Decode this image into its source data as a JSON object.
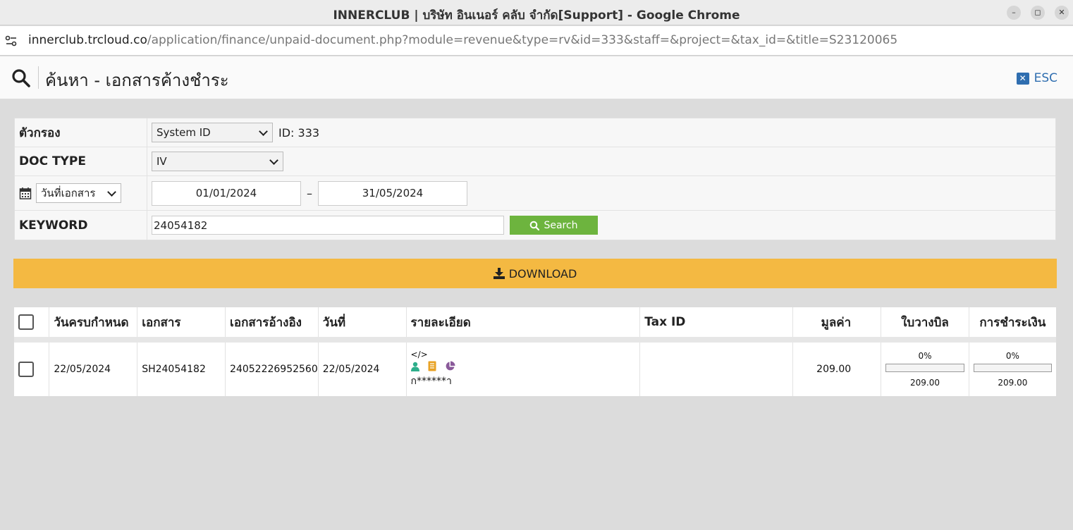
{
  "window": {
    "title": "INNERCLUB | บริษัท อินเนอร์ คลับ จำกัด[Support] - Google Chrome",
    "minimize_glyph": "–",
    "maximize_glyph": "◻",
    "close_glyph": "✕"
  },
  "address": {
    "host": "innerclub.trcloud.co",
    "path": "/application/finance/unpaid-document.php?module=revenue&type=rv&id=333&staff=&project=&tax_id=&title=S23120065"
  },
  "header": {
    "title": "ค้นหา - เอกสารค้างชำระ",
    "esc_label": "ESC"
  },
  "filter": {
    "filter_label": "ตัวกรอง",
    "filter_select": "System ID",
    "filter_value": "ID: 333",
    "doctype_label": "DOC TYPE",
    "doctype_select": "IV",
    "date_select": "วันที่เอกสาร",
    "date_from": "01/01/2024",
    "date_sep": "–",
    "date_to": "31/05/2024",
    "keyword_label": "KEYWORD",
    "keyword_value": "24054182",
    "search_label": "Search"
  },
  "download_label": "DOWNLOAD",
  "table": {
    "headers": [
      "วันครบกำหนด",
      "เอกสาร",
      "เอกสารอ้างอิง",
      "วันที่",
      "รายละเอียด",
      "Tax ID",
      "มูลค่า",
      "ใบวางบิล",
      "การชำระเงิน"
    ],
    "rows": [
      {
        "due_date": "22/05/2024",
        "document": "SH24054182",
        "reference": "24052226952560",
        "date": "22/05/2024",
        "detail_code": "</>",
        "detail_name": "ก******า",
        "tax_id": "",
        "amount": "209.00",
        "billing_percent": "0%",
        "billing_progress": 0,
        "billing_amount": "209.00",
        "payment_percent": "0%",
        "payment_progress": 0,
        "payment_amount": "209.00"
      }
    ]
  },
  "colors": {
    "accent_blue": "#2f6eb0",
    "search_green": "#6db43e",
    "download_orange": "#f4b942",
    "icon_teal": "#2eae8b",
    "icon_orange": "#e8a224",
    "icon_purple": "#8a5a9a"
  },
  "icons": [
    "site-info-icon",
    "search-icon",
    "esc-close-icon",
    "calendar-icon",
    "download-icon",
    "code-icon",
    "user-icon",
    "document-icon",
    "pie-chart-icon"
  ]
}
